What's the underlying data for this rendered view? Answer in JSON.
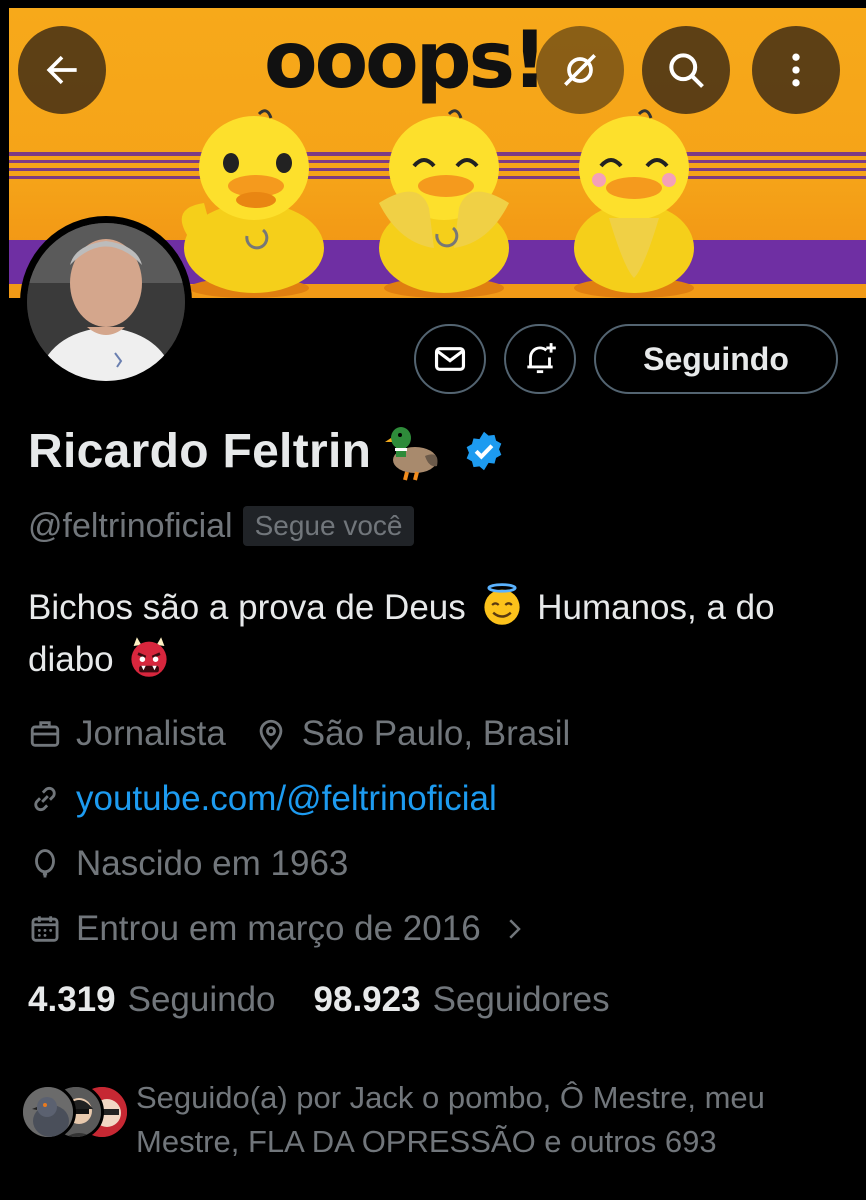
{
  "banner": {
    "word": "ooops!",
    "buttons": {
      "back": "back-arrow-icon",
      "hide": "eye-off-icon",
      "search": "search-icon",
      "more": "more-vertical-icon"
    }
  },
  "actions": {
    "message": "mail-icon",
    "notify": "bell-plus-icon",
    "follow_label": "Seguindo"
  },
  "profile": {
    "name": "Ricardo Feltrin",
    "name_emoji": "duck-emoji",
    "verified": true,
    "handle": "@feltrinoficial",
    "follows_you": "Segue você",
    "bio_part1": "Bichos são a prova de Deus",
    "bio_emoji1": "smiling-face-with-halo",
    "bio_part2": "Humanos, a do diabo",
    "bio_emoji2": "ogre",
    "profession": "Jornalista",
    "location": "São Paulo, Brasil",
    "link": "youtube.com/@feltrinoficial",
    "birth": "Nascido em 1963",
    "joined": "Entrou em março de 2016"
  },
  "stats": {
    "following_count": "4.319",
    "following_label": "Seguindo",
    "followers_count": "98.923",
    "followers_label": "Seguidores"
  },
  "followed_by": {
    "text": "Seguido(a) por Jack o pombo, Ô Mestre, meu Mestre, FLA DA OPRESSÃO e outros 693"
  },
  "colors": {
    "background": "#000000",
    "text": "#e7e9ea",
    "muted": "#71767b",
    "link": "#1d9bf0",
    "verified": "#1d9bf0",
    "banner_orange": "#f5a318",
    "banner_purple": "#6f2fa3"
  }
}
